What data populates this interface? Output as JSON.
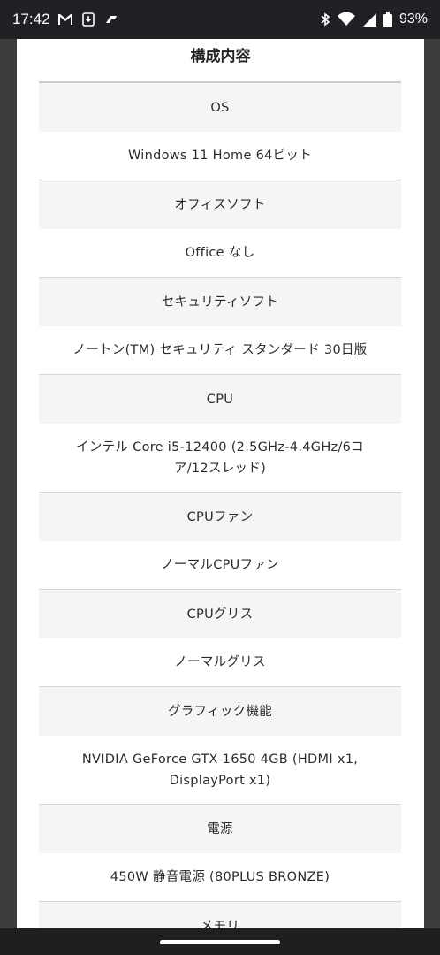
{
  "status_bar": {
    "time": "17:42",
    "battery_percent": "93%",
    "icons": [
      "gmail-icon",
      "download-icon",
      "app-logo-icon",
      "bluetooth-icon",
      "wifi-icon",
      "signal-icon",
      "battery-icon"
    ]
  },
  "section": {
    "title": "構成内容"
  },
  "spec_rows": [
    {
      "label": "OS",
      "value": "Windows 11 Home 64ビット"
    },
    {
      "label": "オフィスソフト",
      "value": "Office なし"
    },
    {
      "label": "セキュリティソフト",
      "value": "ノートン(TM) セキュリティ スタンダード 30日版"
    },
    {
      "label": "CPU",
      "value": "インテル Core i5-12400 (2.5GHz-4.4GHz/6コア/12スレッド)"
    },
    {
      "label": "CPUファン",
      "value": "ノーマルCPUファン"
    },
    {
      "label": "CPUグリス",
      "value": "ノーマルグリス"
    },
    {
      "label": "グラフィック機能",
      "value": "NVIDIA GeForce GTX 1650 4GB (HDMI x1, DisplayPort x1)"
    },
    {
      "label": "電源",
      "value": "450W 静音電源 (80PLUS BRONZE)"
    },
    {
      "label": "メモリ",
      "value": ""
    }
  ]
}
